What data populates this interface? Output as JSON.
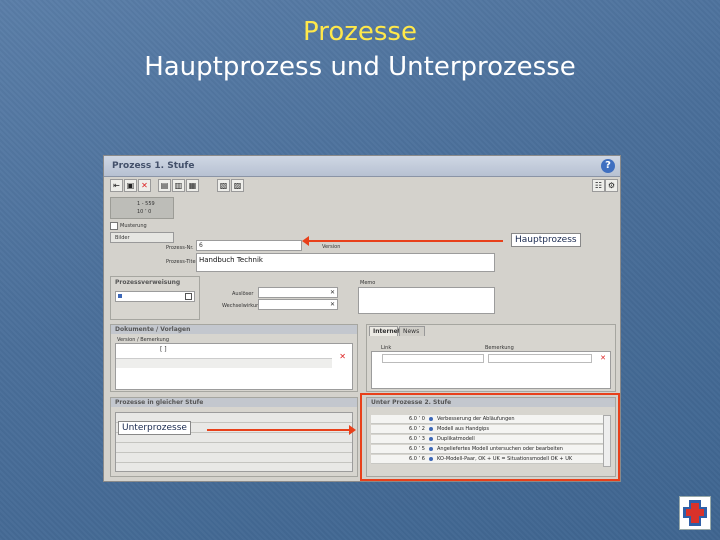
{
  "slide": {
    "title": "Prozesse",
    "subtitle": "Hauptprozess und Unterprozesse"
  },
  "window": {
    "title": "Prozess 1. Stufe",
    "help_icon": "?",
    "id_line1": "1 - 559",
    "id_line2": "10 ’ 0",
    "checkbox_label": "Musterung",
    "button_label": "Bilder",
    "fields": {
      "prozess_nr_label": "Prozess-Nr.",
      "prozess_nr_value": "6",
      "version_label": "Version",
      "prozess_titel_label": "Prozess-Titel",
      "prozess_titel_value": "Handbuch Technik"
    },
    "panels": {
      "verweisung_title": "Prozessverweisung",
      "ausloeser_label": "Auslöser",
      "wechsel_label": "Wechselwirkung",
      "memo_label": "Memo",
      "dokumente_title": "Dokumente / Vorlagen",
      "dokumente_col": "Version / Bemerkung",
      "internet_tab": "Internet",
      "news_tab": "News",
      "link_label": "Link",
      "bemerkung_label": "Bemerkung",
      "gleiche_stufe_title": "Prozesse in gleicher Stufe",
      "unter_title": "Unter Prozesse 2. Stufe"
    },
    "sub_processes": [
      {
        "version": "6.0 ’ 0",
        "name": "Verbesserung der Abläufungen"
      },
      {
        "version": "6.0 ’ 2",
        "name": "Modell aus Handgips"
      },
      {
        "version": "6.0 ’ 3",
        "name": "Duplikatmodell"
      },
      {
        "version": "6.0 ’ 5",
        "name": "Angeliefertes Modell untersuchen oder bearbeiten"
      },
      {
        "version": "6.0 ’ 6",
        "name": "KO-Modell-Paar, OK + UK = Situationsmodell OK + UK"
      }
    ]
  },
  "callouts": {
    "haupt": "Hauptprozess",
    "unter": "Unterprozesse"
  },
  "colors": {
    "accent": "#e8401a",
    "title": "#ffe84a"
  }
}
